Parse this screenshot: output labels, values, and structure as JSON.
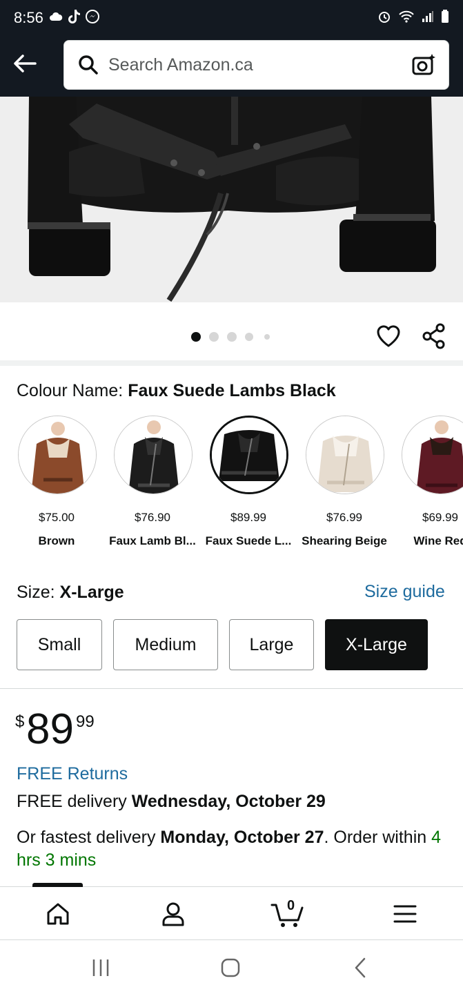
{
  "status_bar": {
    "time": "8:56",
    "left_icons": [
      "cloud-icon",
      "tiktok-icon",
      "messenger-icon"
    ],
    "right_icons": [
      "alarm-icon",
      "wifi-icon",
      "signal-icon",
      "battery-icon"
    ]
  },
  "header": {
    "search_placeholder": "Search Amazon.ca",
    "back_icon": "back-arrow-icon",
    "camera_icon": "camera-search-icon"
  },
  "carousel": {
    "dot_count": 5,
    "active_dot": 0
  },
  "colour": {
    "label": "Colour Name:",
    "value": "Faux Suede Lambs Black",
    "swatches": [
      {
        "price": "$75.00",
        "name": "Brown",
        "color": "#8b4a2b",
        "selected": false
      },
      {
        "price": "$76.90",
        "name": "Faux Lamb Bl...",
        "color": "#1c1c1c",
        "selected": false
      },
      {
        "price": "$89.99",
        "name": "Faux Suede L...",
        "color": "#121212",
        "selected": true
      },
      {
        "price": "$76.99",
        "name": "Shearing Beige",
        "color": "#e6dccf",
        "selected": false
      },
      {
        "price": "$69.99",
        "name": "Wine Red",
        "color": "#5e1a24",
        "selected": false
      }
    ]
  },
  "size": {
    "label": "Size:",
    "value": "X-Large",
    "guide_label": "Size guide",
    "options": [
      "Small",
      "Medium",
      "Large",
      "X-Large"
    ],
    "selected": "X-Large"
  },
  "price": {
    "symbol": "$",
    "whole": "89",
    "fraction": "99"
  },
  "delivery": {
    "free_returns": "FREE Returns",
    "free_delivery_prefix": "FREE delivery",
    "free_delivery_date": "Wednesday, October 29",
    "fastest_prefix": "Or fastest delivery",
    "fastest_date": "Monday, October 27",
    "order_within": ". Order within",
    "countdown": "4 hrs 3 mins"
  },
  "bottom_nav": {
    "items": [
      "home-icon",
      "account-icon",
      "cart-icon",
      "menu-icon"
    ],
    "cart_count": "0"
  },
  "android_nav": [
    "recents-icon",
    "home-circle-icon",
    "android-back-icon"
  ],
  "colors": {
    "header_bg": "#131921",
    "link_blue": "#1e6b9e",
    "countdown_green": "#007600"
  }
}
